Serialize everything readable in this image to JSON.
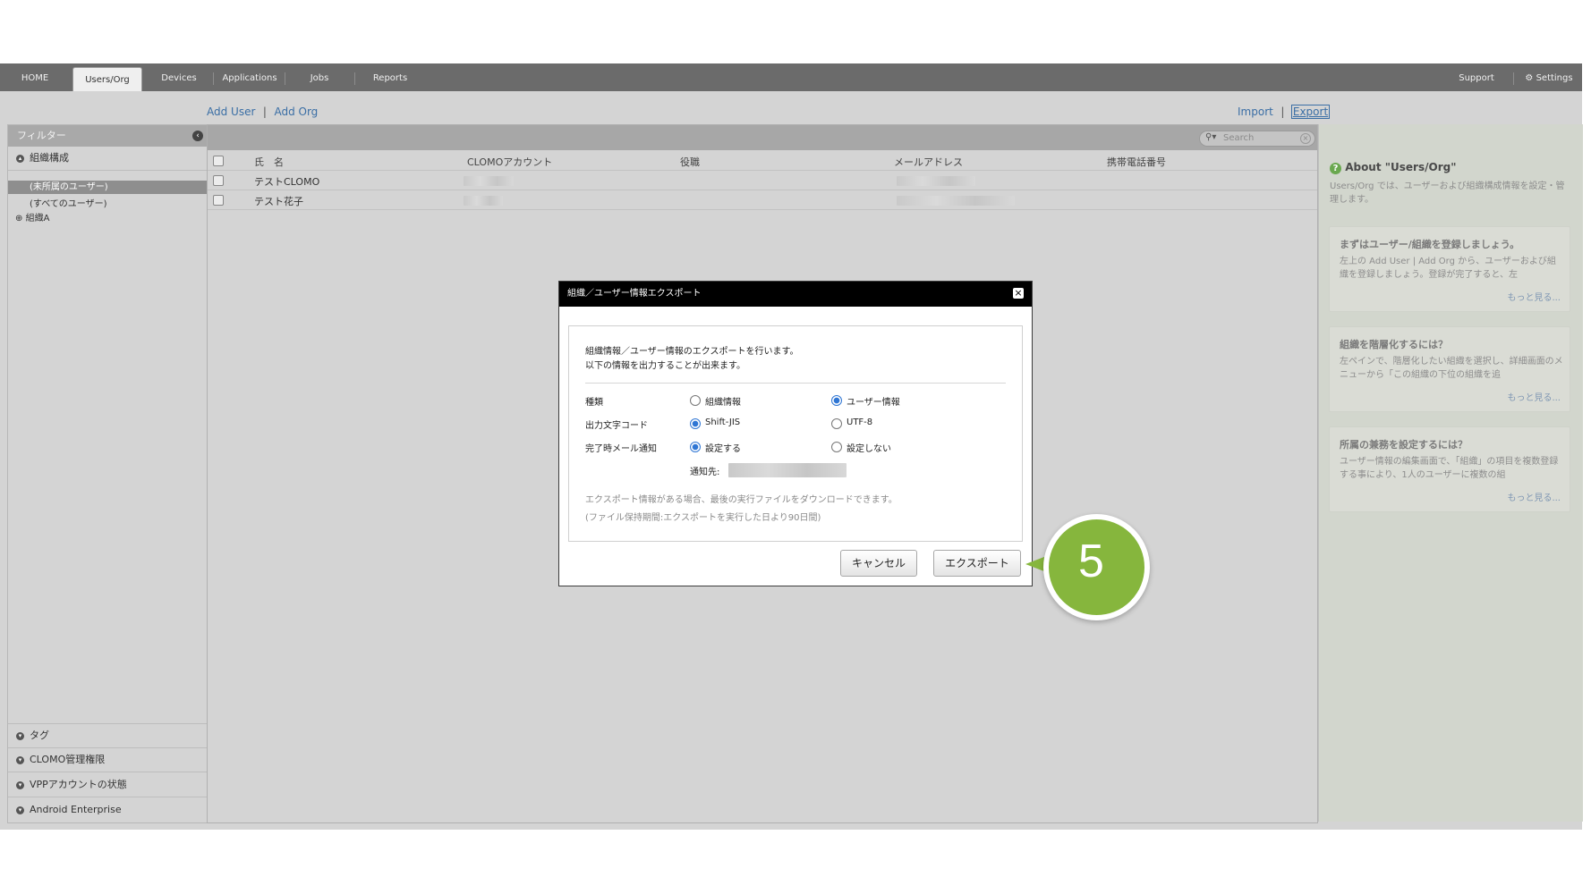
{
  "nav": {
    "tabs": [
      {
        "label": "HOME"
      },
      {
        "label": "Users/Org",
        "active": true
      },
      {
        "label": "Devices"
      },
      {
        "label": "Applications"
      },
      {
        "label": "Jobs"
      },
      {
        "label": "Reports"
      }
    ],
    "support": "Support",
    "settings": "Settings"
  },
  "actions": {
    "add_user": "Add User",
    "add_org": "Add Org",
    "import": "Import",
    "export": "Export",
    "sep": "|"
  },
  "sidebar": {
    "filter_label": "フィルター",
    "org_section": "組織構成",
    "tree": [
      "(未所属のユーザー)",
      "(すべてのユーザー)",
      "組織A"
    ],
    "sections": [
      "タグ",
      "CLOMO管理権限",
      "VPPアカウントの状態",
      "Android Enterprise"
    ]
  },
  "list": {
    "search_placeholder": "Search",
    "columns": [
      "氏　名",
      "CLOMOアカウント",
      "役職",
      "メールアドレス",
      "携帯電話番号"
    ],
    "rows": [
      {
        "name": "テストCLOMO"
      },
      {
        "name": "テスト花子"
      }
    ]
  },
  "about": {
    "title": "About \"Users/Org\"",
    "desc": "Users/Org では、ユーザーおよび組織構成情報を設定・管理します。",
    "tips": [
      {
        "title": "まずはユーザー/組織を登録しましょう。",
        "body": "左上の Add User | Add Org から、ユーザーおよび組織を登録しましょう。登録が完了すると、左",
        "more": "もっと見る..."
      },
      {
        "title": "組織を階層化するには？",
        "body": "左ペインで、階層化したい組織を選択し、詳細画面のメニューから「この組織の下位の組織を追",
        "more": "もっと見る..."
      },
      {
        "title": "所属の兼務を設定するには？",
        "body": "ユーザー情報の編集画面で、「組織」の項目を複数登録する事により、1人のユーザーに複数の組",
        "more": "もっと見る..."
      }
    ]
  },
  "modal": {
    "title": "組織／ユーザー情報エクスポート",
    "intro1": "組織情報／ユーザー情報のエクスポートを行います。",
    "intro2": "以下の情報を出力することが出来ます。",
    "type_label": "種類",
    "type_opt1": "組織情報",
    "type_opt2": "ユーザー情報",
    "enc_label": "出力文字コード",
    "enc_opt1": "Shift-JIS",
    "enc_opt2": "UTF-8",
    "mail_label": "完了時メール通知",
    "mail_opt1": "設定する",
    "mail_opt2": "設定しない",
    "notify_label": "通知先:",
    "note1": "エクスポート情報がある場合、最後の実行ファイルをダウンロードできます。",
    "note2": "(ファイル保持期間:エクスポートを実行した日より90日間)",
    "cancel": "キャンセル",
    "export": "エクスポート",
    "selected": {
      "type": "ユーザー情報",
      "encoding": "Shift-JIS",
      "mail": "設定する"
    }
  },
  "step_badge": "5",
  "colors": {
    "badge": "#86b63d",
    "link": "#3a6ea5",
    "radio": "#2f76d4"
  }
}
